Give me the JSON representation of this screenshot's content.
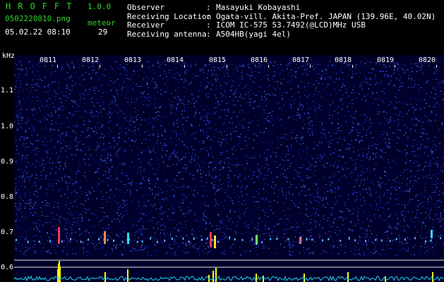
{
  "header": {
    "brand": "HROFFT",
    "version": "1.0.0",
    "filename": "0502220810.png",
    "meteor_label": "meteor",
    "datetime": "05.02.22 08:10",
    "meteor_count": "29",
    "info": [
      {
        "key": "Observer",
        "value": "Masayuki Kobayashi"
      },
      {
        "key": "Receiving Location",
        "value": "Ogata-vill. Akita-Pref. JAPAN (139.96E, 40.02N)"
      },
      {
        "key": "Receiver",
        "value": "ICOM IC-575 53.7492(@LCD)MHz USB"
      },
      {
        "key": "Receiving antenna",
        "value": "A504HB(yagi 4el)"
      }
    ]
  },
  "axis": {
    "unit": "kHz",
    "y_labels": [
      "1.1",
      "1.0",
      "0.9",
      "0.8",
      "0.7",
      "0.6"
    ],
    "time_labels": [
      "0811",
      "0812",
      "0813",
      "0814",
      "0815",
      "0816",
      "0817",
      "0818",
      "0819",
      "0820"
    ]
  },
  "colors": {
    "background": "#000000",
    "brand": "#2ed12e",
    "spectrum_bg": "#00002a",
    "level_trace": "#22d3ee",
    "meteor_bar": "#ffff00"
  }
}
